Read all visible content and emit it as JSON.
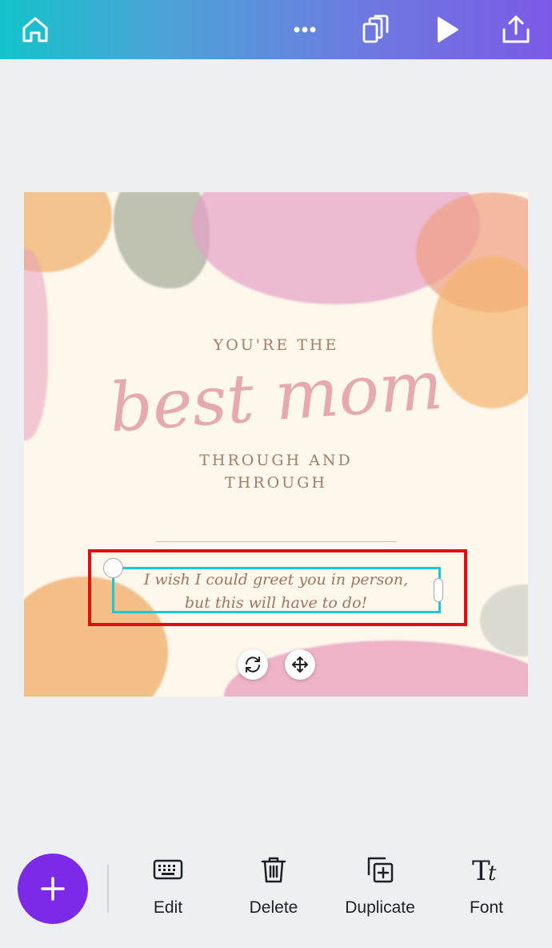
{
  "topbar": {
    "icons": [
      "home-icon",
      "more-icon",
      "pages-icon",
      "play-icon",
      "share-icon"
    ]
  },
  "design": {
    "line1": "YOU'RE THE",
    "script": "best mom",
    "line2": "THROUGH AND",
    "line3": "THROUGH",
    "message_line1": "I wish I could greet you in person,",
    "message_line2": "but this will have to do!"
  },
  "toolbar": {
    "add_icon": "plus-icon",
    "items": [
      {
        "label": "Edit",
        "icon": "keyboard-icon"
      },
      {
        "label": "Delete",
        "icon": "trash-icon"
      },
      {
        "label": "Duplicate",
        "icon": "duplicate-icon"
      },
      {
        "label": "Font",
        "icon": "font-icon"
      }
    ]
  },
  "colors": {
    "accent": "#7d2ae8",
    "selection": "#1fc6d6",
    "highlight": "#e01010"
  }
}
